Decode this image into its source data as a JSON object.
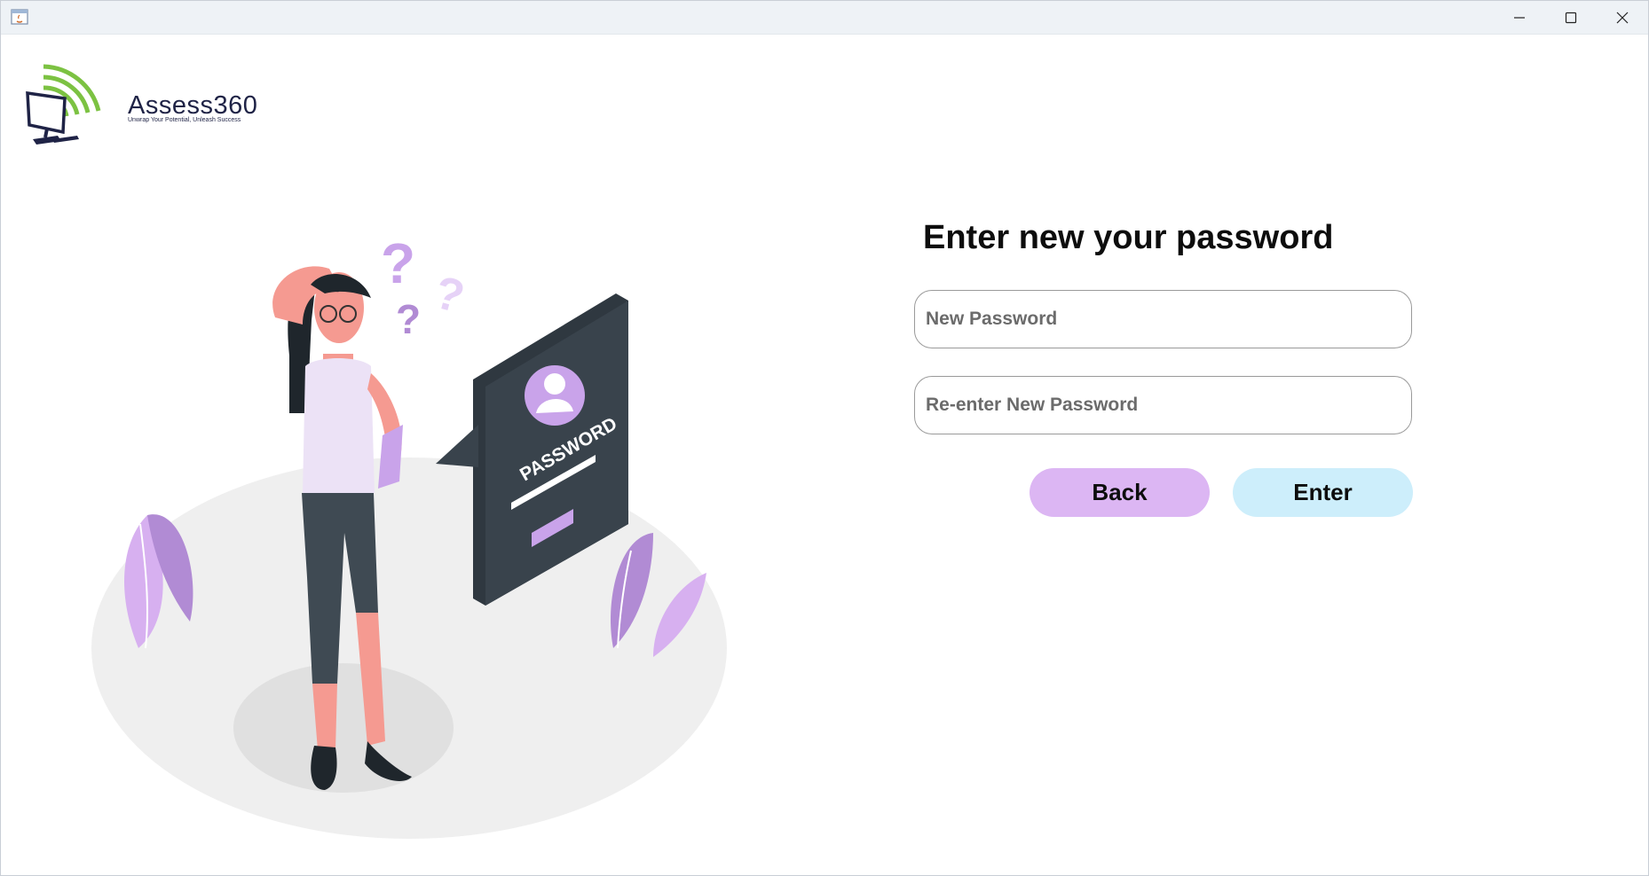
{
  "window": {
    "controls": {
      "minimize_icon": "minimize-icon",
      "maximize_icon": "maximize-icon",
      "close_icon": "close-icon"
    }
  },
  "logo": {
    "name": "Assess360",
    "tagline": "Unwrap Your Potential, Unleash Success"
  },
  "illustration": {
    "sign_text": "PASSWORD"
  },
  "form": {
    "heading": "Enter new your password",
    "new_password": {
      "placeholder": "New Password",
      "value": ""
    },
    "reenter_password": {
      "placeholder": "Re-enter New Password",
      "value": ""
    },
    "back_label": "Back",
    "enter_label": "Enter"
  },
  "colors": {
    "back_button": "#dcb6f3",
    "enter_button": "#cdeefb",
    "accent_purple": "#c9a3ea",
    "logo_green": "#7cc242"
  }
}
